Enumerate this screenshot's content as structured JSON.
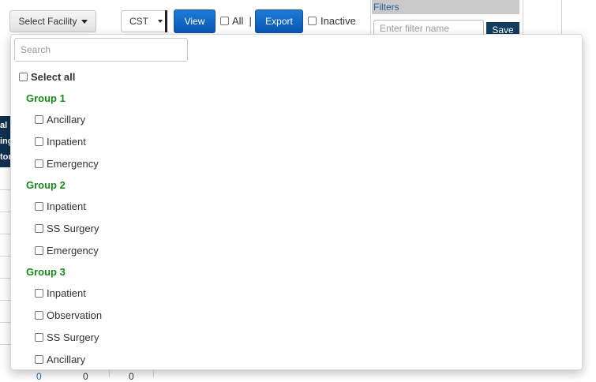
{
  "toolbar": {
    "facility_button": "Select Facility",
    "timezone_value": "CST",
    "view_button": "View",
    "all_label": "All",
    "separator": "|",
    "export_button": "Export",
    "inactive_label": "Inactive"
  },
  "filters": {
    "title": "Filters",
    "name_placeholder": "Enter filter name",
    "save_button": "Save"
  },
  "background": {
    "dark_cell_fragments": [
      "al",
      "ing",
      "tor"
    ],
    "bottom_values": [
      "0",
      "0",
      "0"
    ]
  },
  "dropdown": {
    "search_placeholder": "Search",
    "select_all_label": "Select all",
    "groups": [
      {
        "label": "Group 1",
        "items": [
          "Ancillary",
          "Inpatient",
          "Emergency"
        ]
      },
      {
        "label": "Group 2",
        "items": [
          "Inpatient",
          "SS Surgery",
          "Emergency"
        ]
      },
      {
        "label": "Group 3",
        "items": [
          "Inpatient",
          "Observation",
          "SS Surgery",
          "Ancillary"
        ]
      }
    ]
  },
  "colors": {
    "accent_blue": "#0b55b4",
    "group_green": "#1a8a1a",
    "dark_navy": "#0f3050",
    "save_navy": "#123d5c"
  }
}
